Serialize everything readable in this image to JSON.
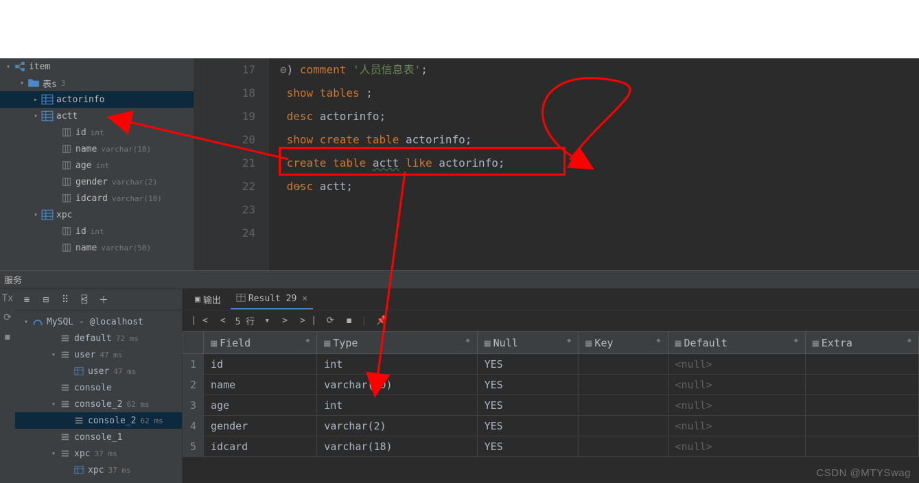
{
  "sidebar": {
    "root": {
      "label": "item"
    },
    "tables_group": {
      "label": "表s",
      "count": "3"
    },
    "tables": [
      {
        "name": "actorinfo"
      },
      {
        "name": "actt",
        "columns": [
          {
            "name": "id",
            "type": "int"
          },
          {
            "name": "name",
            "type": "varchar(10)"
          },
          {
            "name": "age",
            "type": "int"
          },
          {
            "name": "gender",
            "type": "varchar(2)"
          },
          {
            "name": "idcard",
            "type": "varchar(18)"
          }
        ]
      },
      {
        "name": "xpc",
        "columns": [
          {
            "name": "id",
            "type": "int"
          },
          {
            "name": "name",
            "type": "varchar(50)"
          }
        ]
      }
    ]
  },
  "editor": {
    "lines": [
      {
        "n": "17",
        "tokens": [
          {
            "t": ") ",
            "c": "punct"
          },
          {
            "t": "comment",
            "c": "kw"
          },
          {
            "t": " ",
            "c": "punct"
          },
          {
            "t": "'人员信息表'",
            "c": "str"
          },
          {
            "t": ";",
            "c": "punct"
          }
        ],
        "fold": true
      },
      {
        "n": "18",
        "tokens": [
          {
            "t": "show tables ",
            "c": "kw"
          },
          {
            "t": ";",
            "c": "punct"
          }
        ]
      },
      {
        "n": "19",
        "tokens": [
          {
            "t": "desc",
            "c": "kw"
          },
          {
            "t": " actorinfo",
            "c": "ident"
          },
          {
            "t": ";",
            "c": "punct"
          }
        ]
      },
      {
        "n": "20",
        "tokens": [
          {
            "t": "show create table",
            "c": "kw"
          },
          {
            "t": " actorinfo",
            "c": "ident"
          },
          {
            "t": ";",
            "c": "punct"
          }
        ]
      },
      {
        "n": "21",
        "tokens": [
          {
            "t": "create table ",
            "c": "kw"
          },
          {
            "t": "actt",
            "c": "ident underline"
          },
          {
            "t": " ",
            "c": "punct"
          },
          {
            "t": "like",
            "c": "kw"
          },
          {
            "t": " actorinfo",
            "c": "ident"
          },
          {
            "t": ";",
            "c": "punct"
          }
        ]
      },
      {
        "n": "22",
        "tokens": [
          {
            "t": "desc",
            "c": "kw"
          },
          {
            "t": " actt",
            "c": "ident"
          },
          {
            "t": ";",
            "c": "punct"
          }
        ],
        "check": true
      },
      {
        "n": "23",
        "tokens": []
      },
      {
        "n": "24",
        "tokens": []
      }
    ]
  },
  "services_label": "服务",
  "services": {
    "root": {
      "label": "MySQL - @localhost"
    },
    "items": [
      {
        "label": "default",
        "meta": "72 ms",
        "indent": 2,
        "chev": ""
      },
      {
        "label": "user",
        "meta": "47 ms",
        "indent": 2,
        "chev": "▾"
      },
      {
        "label": "user",
        "meta": "47 ms",
        "indent": 3,
        "chev": ""
      },
      {
        "label": "console",
        "meta": "",
        "indent": 2,
        "chev": ""
      },
      {
        "label": "console_2",
        "meta": "62 ms",
        "indent": 2,
        "chev": "▾"
      },
      {
        "label": "console_2",
        "meta": "62 ms",
        "indent": 3,
        "chev": "",
        "selected": true
      },
      {
        "label": "console_1",
        "meta": "",
        "indent": 2,
        "chev": ""
      },
      {
        "label": "xpc",
        "meta": "37 ms",
        "indent": 2,
        "chev": "▾"
      },
      {
        "label": "xpc",
        "meta": "37 ms",
        "indent": 3,
        "chev": ""
      }
    ]
  },
  "tabs": {
    "output": "输出",
    "result": "Result 29"
  },
  "nav": {
    "rows_label": "5 行"
  },
  "result": {
    "headers": [
      "Field",
      "Type",
      "Null",
      "Key",
      "Default",
      "Extra"
    ],
    "rows": [
      {
        "n": "1",
        "cells": [
          "id",
          "int",
          "YES",
          "",
          "<null>",
          ""
        ]
      },
      {
        "n": "2",
        "cells": [
          "name",
          "varchar(10)",
          "YES",
          "",
          "<null>",
          ""
        ]
      },
      {
        "n": "3",
        "cells": [
          "age",
          "int",
          "YES",
          "",
          "<null>",
          ""
        ]
      },
      {
        "n": "4",
        "cells": [
          "gender",
          "varchar(2)",
          "YES",
          "",
          "<null>",
          ""
        ]
      },
      {
        "n": "5",
        "cells": [
          "idcard",
          "varchar(18)",
          "YES",
          "",
          "<null>",
          ""
        ]
      }
    ]
  },
  "watermark": "CSDN @MTYSwag"
}
